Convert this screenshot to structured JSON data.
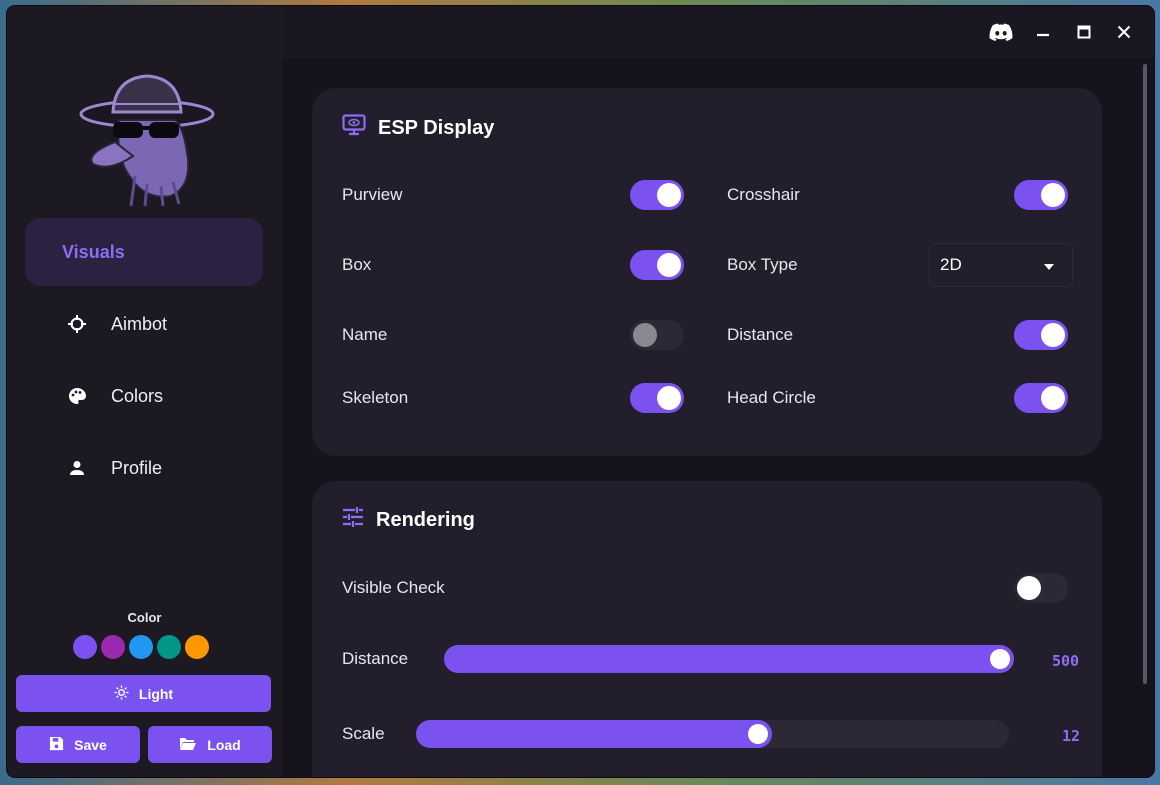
{
  "titlebar": {
    "icons": [
      "discord-icon",
      "minimize-icon",
      "maximize-icon",
      "close-icon"
    ]
  },
  "sidebar": {
    "items": [
      {
        "label": "Visuals",
        "icon": "none",
        "active": true
      },
      {
        "label": "Aimbot",
        "icon": "crosshair-icon"
      },
      {
        "label": "Colors",
        "icon": "palette-icon"
      },
      {
        "label": "Profile",
        "icon": "person-icon"
      }
    ],
    "color_label": "Color",
    "swatches": [
      "#7b52ef",
      "#9c27b0",
      "#2196f3",
      "#009688",
      "#ff9800"
    ],
    "theme_button": "Light",
    "save_button": "Save",
    "load_button": "Load"
  },
  "esp": {
    "title": "ESP Display",
    "purview": {
      "label": "Purview",
      "on": true
    },
    "crosshair": {
      "label": "Crosshair",
      "on": true
    },
    "box": {
      "label": "Box",
      "on": true
    },
    "box_type": {
      "label": "Box Type",
      "value": "2D"
    },
    "name": {
      "label": "Name",
      "on": false
    },
    "distance": {
      "label": "Distance",
      "on": true
    },
    "skeleton": {
      "label": "Skeleton",
      "on": true
    },
    "head_circle": {
      "label": "Head Circle",
      "on": true
    }
  },
  "rendering": {
    "title": "Rendering",
    "visible_check": {
      "label": "Visible Check",
      "on": false
    },
    "distance": {
      "label": "Distance",
      "value": "500",
      "fill": 1.0
    },
    "scale": {
      "label": "Scale",
      "value": "12",
      "fill": 0.6
    }
  },
  "colors": {
    "accent": "#7b52ef",
    "accent_text": "#8f6cf2"
  }
}
